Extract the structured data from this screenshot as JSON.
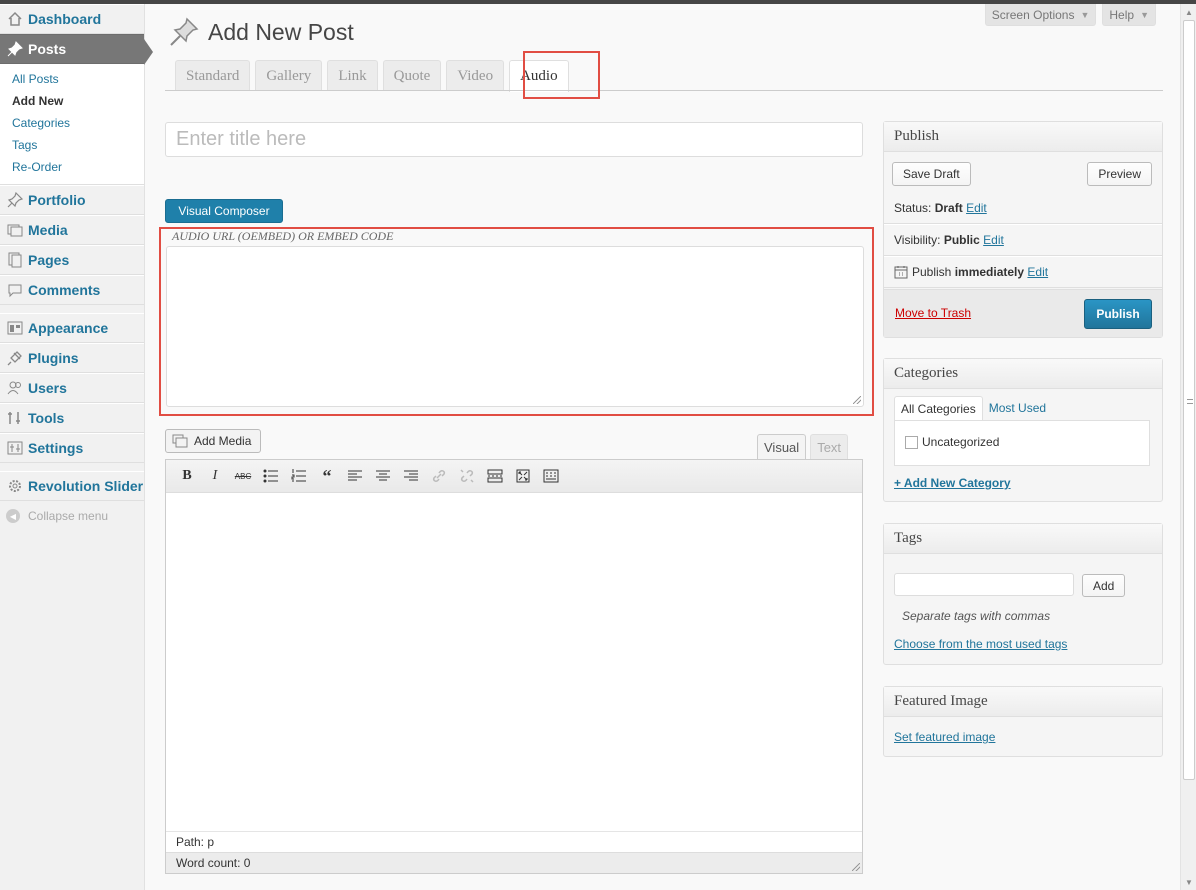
{
  "sidebar": {
    "top_items": [
      {
        "label": "Dashboard",
        "icon": "dashboard-icon"
      },
      {
        "label": "Posts",
        "icon": "pushpin-icon"
      }
    ],
    "posts_submenu": [
      "All Posts",
      "Add New",
      "Categories",
      "Tags",
      "Re-Order"
    ],
    "mid_items": [
      {
        "label": "Portfolio",
        "icon": "pushpin-icon"
      },
      {
        "label": "Media",
        "icon": "media-icon"
      },
      {
        "label": "Pages",
        "icon": "pages-icon"
      },
      {
        "label": "Comments",
        "icon": "comments-icon"
      }
    ],
    "lower_items": [
      {
        "label": "Appearance",
        "icon": "appearance-icon"
      },
      {
        "label": "Plugins",
        "icon": "plugins-icon"
      },
      {
        "label": "Users",
        "icon": "users-icon"
      },
      {
        "label": "Tools",
        "icon": "tools-icon"
      },
      {
        "label": "Settings",
        "icon": "settings-icon"
      }
    ],
    "slider_item": {
      "label": "Revolution Slider",
      "icon": "gear-icon"
    },
    "collapse_label": "Collapse menu"
  },
  "header": {
    "screen_options": "Screen Options",
    "help": "Help",
    "title": "Add New Post"
  },
  "format_tabs": [
    "Standard",
    "Gallery",
    "Link",
    "Quote",
    "Video",
    "Audio"
  ],
  "active_format": "Audio",
  "editor": {
    "title_placeholder": "Enter title here",
    "visual_composer": "Visual Composer",
    "audio_label": "AUDIO URL (OEMBED) OR EMBED CODE",
    "add_media": "Add Media",
    "tab_visual": "Visual",
    "tab_text": "Text",
    "path": "Path: p",
    "word_count": "Word count: 0"
  },
  "publish_box": {
    "title": "Publish",
    "save_draft": "Save Draft",
    "preview": "Preview",
    "status_label": "Status:",
    "status_value": "Draft",
    "visibility_label": "Visibility:",
    "visibility_value": "Public",
    "publish_label": "Publish",
    "publish_value": "immediately",
    "edit": "Edit",
    "move_to_trash": "Move to Trash",
    "publish_button": "Publish"
  },
  "categories_box": {
    "title": "Categories",
    "tab_all": "All Categories",
    "tab_most_used": "Most Used",
    "item": "Uncategorized",
    "add_new": "+ Add New Category"
  },
  "tags_box": {
    "title": "Tags",
    "add_button": "Add",
    "hint": "Separate tags with commas",
    "choose": "Choose from the most used tags"
  },
  "featured_box": {
    "title": "Featured Image",
    "set": "Set featured image"
  },
  "colors": {
    "link": "#21759b",
    "primary": "#21759b",
    "highlight": "#e14d43",
    "active_menu": "#777777"
  }
}
